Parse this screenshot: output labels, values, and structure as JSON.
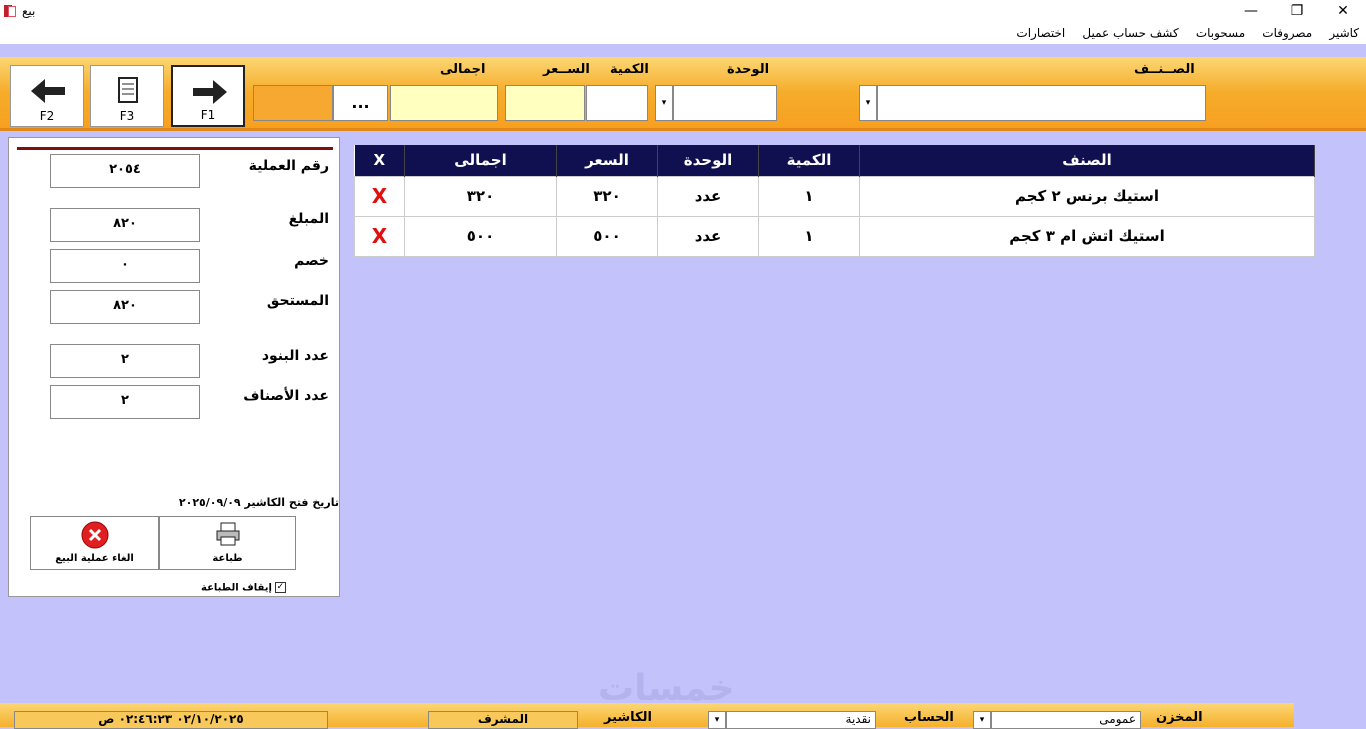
{
  "window": {
    "title": "بيع",
    "minimize": "—",
    "maximize": "❐",
    "close": "✕"
  },
  "menu": [
    "كاشير",
    "مصروفات",
    "مسحوبات",
    "كشف حساب عميل",
    "اختصارات"
  ],
  "toolbar": {
    "f2_label": "F2",
    "f3_label": "F3",
    "f1_label": "F1",
    "browse_label": "...",
    "labels": {
      "total": "اجمالى",
      "price": "الســعر",
      "qty": "الكمية",
      "unit": "الوحدة",
      "item": "الصــنــف"
    },
    "dropdown_glyph": "▾"
  },
  "summary": {
    "op_number_label": "رقم العملية",
    "op_number": "٢٠٥٤",
    "amount_label": "المبلغ",
    "amount": "٨٢٠",
    "discount_label": "خصم",
    "discount": "٠",
    "due_label": "المستحق",
    "due": "٨٢٠",
    "lines_label": "عدد البنود",
    "lines": "٢",
    "kinds_label": "عدد الأصناف",
    "kinds": "٢",
    "open_date_label": "تاريخ فتح الكاشير",
    "open_date": "٢٠٢٥/٠٩/٠٩",
    "print_label": "طباعة",
    "cancel_label": "الغاء عملية البيع",
    "stop_print_label": "إيقاف الطباعة",
    "stop_print_check": "✓"
  },
  "grid": {
    "headers": {
      "x": "X",
      "total": "اجمالى",
      "price": "السعر",
      "unit": "الوحدة",
      "qty": "الكمية",
      "item": "الصنف"
    },
    "rows": [
      {
        "x": "X",
        "total": "٣٢٠",
        "price": "٣٢٠",
        "unit": "عدد",
        "qty": "١",
        "item": "استيك برنس ٢ كجم"
      },
      {
        "x": "X",
        "total": "٥٠٠",
        "price": "٥٠٠",
        "unit": "عدد",
        "qty": "١",
        "item": "استيك اتش ام ٣ كجم"
      }
    ]
  },
  "footer": {
    "datetime": "٠٢/١٠/٢٠٢٥ ٠٢:٤٦:٢٣ ص",
    "supervisor_label": "المشرف",
    "cashier_label": "الكاشير",
    "account_label": "الحساب",
    "account_value": "نقدية",
    "store_label": "المخزن",
    "store_value": "عمومى"
  },
  "watermark": "خمسات",
  "colors": {
    "toolbar": "#f6ac2a",
    "background": "#c3c2fa",
    "grid_header": "#101050",
    "delete_x": "#e01010"
  }
}
